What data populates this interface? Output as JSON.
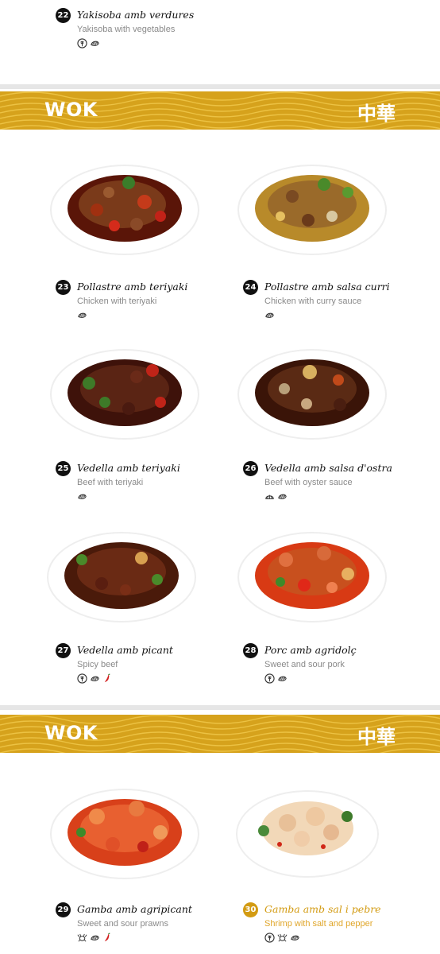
{
  "top_item": {
    "number": "22",
    "name": "Yakisoba amb verdures",
    "subtitle": "Yakisoba with vegetables",
    "icons": [
      "wheat-icon",
      "mollusc-icon"
    ]
  },
  "sections": [
    {
      "banner": {
        "title": "WOK",
        "chinese": "中華"
      },
      "items": [
        {
          "number": "23",
          "name": "Pollastre amb teriyaki",
          "subtitle": "Chicken with teriyaki",
          "icons": [
            "mollusc-icon"
          ],
          "highlight": false
        },
        {
          "number": "24",
          "name": "Pollastre amb salsa curri",
          "subtitle": "Chicken with curry sauce",
          "icons": [
            "mollusc-icon"
          ],
          "highlight": false
        },
        {
          "number": "25",
          "name": "Vedella amb teriyaki",
          "subtitle": "Beef with teriyaki",
          "icons": [
            "mollusc-icon"
          ],
          "highlight": false
        },
        {
          "number": "26",
          "name": "Vedella amb salsa d'ostra",
          "subtitle": "Beef with oyster sauce",
          "icons": [
            "shell-icon",
            "mollusc-icon"
          ],
          "highlight": false
        },
        {
          "number": "27",
          "name": "Vedella amb picant",
          "subtitle": "Spicy beef",
          "icons": [
            "wheat-icon",
            "mollusc-icon",
            "chili-icon"
          ],
          "highlight": false
        },
        {
          "number": "28",
          "name": "Porc amb agridolç",
          "subtitle": "Sweet and sour pork",
          "icons": [
            "wheat-icon",
            "mollusc-icon"
          ],
          "highlight": false
        }
      ]
    },
    {
      "banner": {
        "title": "WOK",
        "chinese": "中華"
      },
      "items": [
        {
          "number": "29",
          "name": "Gamba amb agripicant",
          "subtitle": "Sweet and sour prawns",
          "icons": [
            "crustacean-icon",
            "mollusc-icon",
            "chili-icon"
          ],
          "highlight": false
        },
        {
          "number": "30",
          "name": "Gamba amb sal i pebre",
          "subtitle": "Shrimp with salt and pepper",
          "icons": [
            "wheat-icon",
            "crustacean-icon",
            "mollusc-icon"
          ],
          "highlight": true
        }
      ]
    }
  ],
  "colors": {
    "banner": "#d6a21c",
    "highlight": "#d39b12",
    "badge": "#111111"
  }
}
